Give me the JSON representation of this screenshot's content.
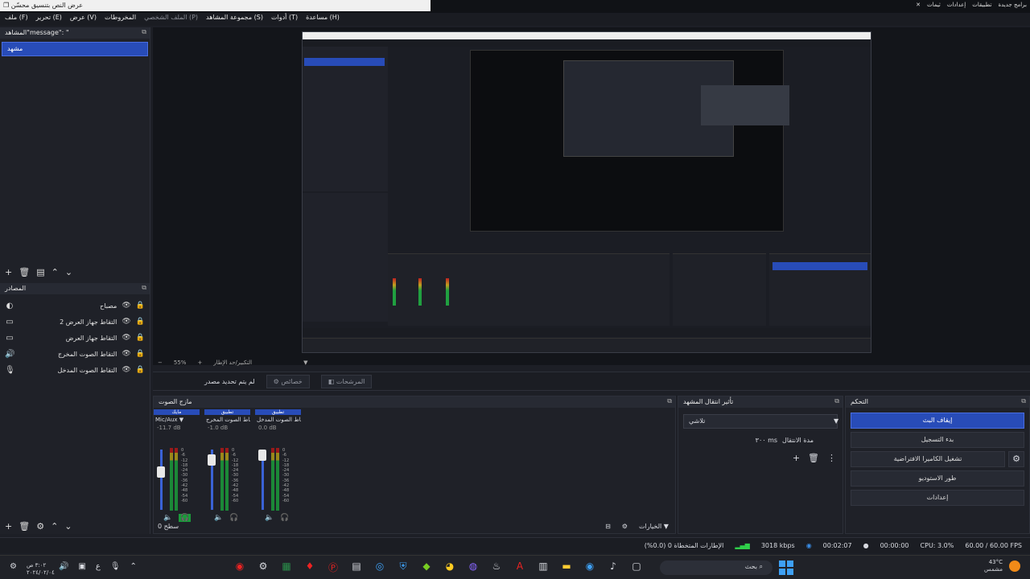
{
  "window": {
    "title": "عرض النص بتنسيق محسّن",
    "controls": [
      "—",
      "❐",
      "✕"
    ]
  },
  "topright": [
    "برامج جديدة",
    "تطبيقات",
    "إعدادات",
    "ثيمات"
  ],
  "menu": [
    {
      "label": "ملف (F)",
      "dim": false
    },
    {
      "label": "تحرير (E)",
      "dim": false
    },
    {
      "label": "عرض (V)",
      "dim": false
    },
    {
      "label": "المخروطات",
      "dim": false
    },
    {
      "label": "الملف الشخصي (P)",
      "dim": true
    },
    {
      "label": "مجموعة المشاهد (S)",
      "dim": false
    },
    {
      "label": "أدوات (T)",
      "dim": false
    },
    {
      "label": "مساعدة (H)",
      "dim": false
    }
  ],
  "scenes": {
    "title": "المشاهد\"message\": \"",
    "items": [
      "مشهد"
    ],
    "toolbar": [
      "+",
      "🗑",
      "▤",
      "⌃",
      "⌄"
    ]
  },
  "sources": {
    "title": "المصادر",
    "items": [
      {
        "label": "مصباح",
        "icon": "lamp-icon",
        "glyph": "◐"
      },
      {
        "label": "التقاط جهاز العرض 2",
        "icon": "monitor-icon",
        "glyph": "▭"
      },
      {
        "label": "التقاط جهاز العرض",
        "icon": "monitor-icon",
        "glyph": "▭"
      },
      {
        "label": "التقاط الصوت المخرج",
        "icon": "speaker-icon",
        "glyph": "🔊"
      },
      {
        "label": "التقاط الصوت المدخل",
        "icon": "microphone-icon",
        "glyph": "🎙"
      }
    ],
    "toolbar": [
      "+",
      "🗑",
      "⚙",
      "⌃",
      "⌄"
    ]
  },
  "zoom": {
    "value": "55%",
    "minus": "−",
    "plus": "+",
    "label": "التكبير/حد الإطار"
  },
  "propsbar": {
    "no_source": "لم يتم تحديد مصدر",
    "properties": "خصائص",
    "filters": "المرشحات"
  },
  "mixer": {
    "title": "مازج الصوت",
    "footer": "سطح 0",
    "channels": [
      {
        "name": "مايك",
        "device": "Mic/Aux",
        "db": "-11.7 dB",
        "level": 0.65
      },
      {
        "name": "تطبيق",
        "device": "التقاط الصوت المخرج",
        "db": "-1.0 dB",
        "level": 0.9
      },
      {
        "name": "تطبيق",
        "device": "التقاط الصوت المدخل",
        "db": "0.0 dB",
        "level": 1.0
      }
    ],
    "scale": [
      "0",
      "-6",
      "-12",
      "-18",
      "-24",
      "-30",
      "-36",
      "-42",
      "-48",
      "-54",
      "-60"
    ]
  },
  "transitions": {
    "title": "تأثير انتقال المشهد",
    "type": "تلاشي",
    "duration_label": "مدة الانتقال",
    "duration_value": "٣٠٠ ms"
  },
  "controls": {
    "title": "التحكم",
    "buttons": [
      "إيقاف البث",
      "بدء التسجيل",
      "تشغيل الكاميرا الافتراضية",
      "طور الاستوديو",
      "إعدادات"
    ]
  },
  "bottom": {
    "options_label": "الخيارات"
  },
  "status": {
    "dropped": "الإطارات المتخطاة 0 (0.0%)",
    "bitrate": "3018 kbps",
    "stream_time": "00:02:07",
    "rec_time": "00:00:00",
    "cpu": "CPU: 3.0%",
    "fps": "60.00 / 60.00 FPS"
  },
  "taskbar": {
    "time": "٣:٠٢ ص",
    "date": "٢٠٢٤/٠٢/٠٤",
    "lang": "ع",
    "search": "بحث",
    "temp": "43°C",
    "weather": "مشمس"
  },
  "colors": {
    "accent": "#284cb8",
    "panel": "#1f2128",
    "meter_green": "#1a9a3a"
  }
}
